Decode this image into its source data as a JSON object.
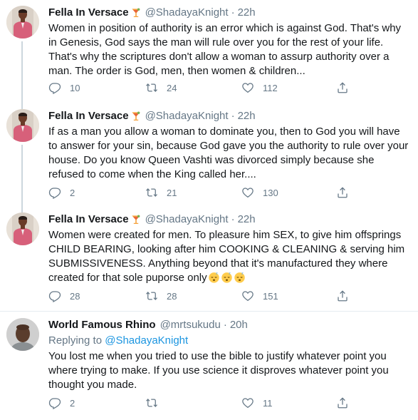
{
  "tweets": [
    {
      "name": "Fella In Versace",
      "handle": "@ShadayaKnight",
      "dot": "·",
      "time": "22h",
      "text": "Women in position of authority is an error which is against God. That's why in Genesis, God says the man will rule over you for the rest of your life. That's why the scriptures don't allow a woman to assurp authority over a man. The order is God, men, then women & children...",
      "replies": "10",
      "retweets": "24",
      "likes": "112"
    },
    {
      "name": "Fella In Versace",
      "handle": "@ShadayaKnight",
      "dot": "·",
      "time": "22h",
      "text": "If as a man you allow a woman to dominate you, then to God you will have to answer for your sin, because God gave you the authority to rule over your house. Do you know Queen Vashti was divorced simply because she refused to come when the King called her....",
      "replies": "2",
      "retweets": "21",
      "likes": "130"
    },
    {
      "name": "Fella In Versace",
      "handle": "@ShadayaKnight",
      "dot": "·",
      "time": "22h",
      "text": "Women were created for men. To pleasure him SEX, to give him offsprings CHILD BEARING, looking after him COOKING & CLEANING & serving him SUBMISSIVENESS. Anything beyond that it's manufactured they where created for that sole puporse only",
      "replies": "28",
      "retweets": "28",
      "likes": "151"
    },
    {
      "name": "World Famous Rhino",
      "handle": "@mrtsukudu",
      "dot": "·",
      "time": "20h",
      "replying_prefix": "Replying to",
      "replying_mention": "@ShadayaKnight",
      "text": "You lost me when you tried to use the bible to justify whatever point you where trying to make. If you use science it disproves whatever point you thought you made.",
      "replies": "2",
      "retweets": "",
      "likes": "11"
    }
  ],
  "colors": {
    "text": "#14171a",
    "secondary": "#657786",
    "link": "#1b95e0",
    "divider": "#e6ecf0",
    "thread_line": "#ccd6dd"
  },
  "icons": [
    "cocktail-emoji-icon",
    "reply-icon",
    "retweet-icon",
    "like-icon",
    "share-icon",
    "sleeping-face-emoji-icon"
  ]
}
